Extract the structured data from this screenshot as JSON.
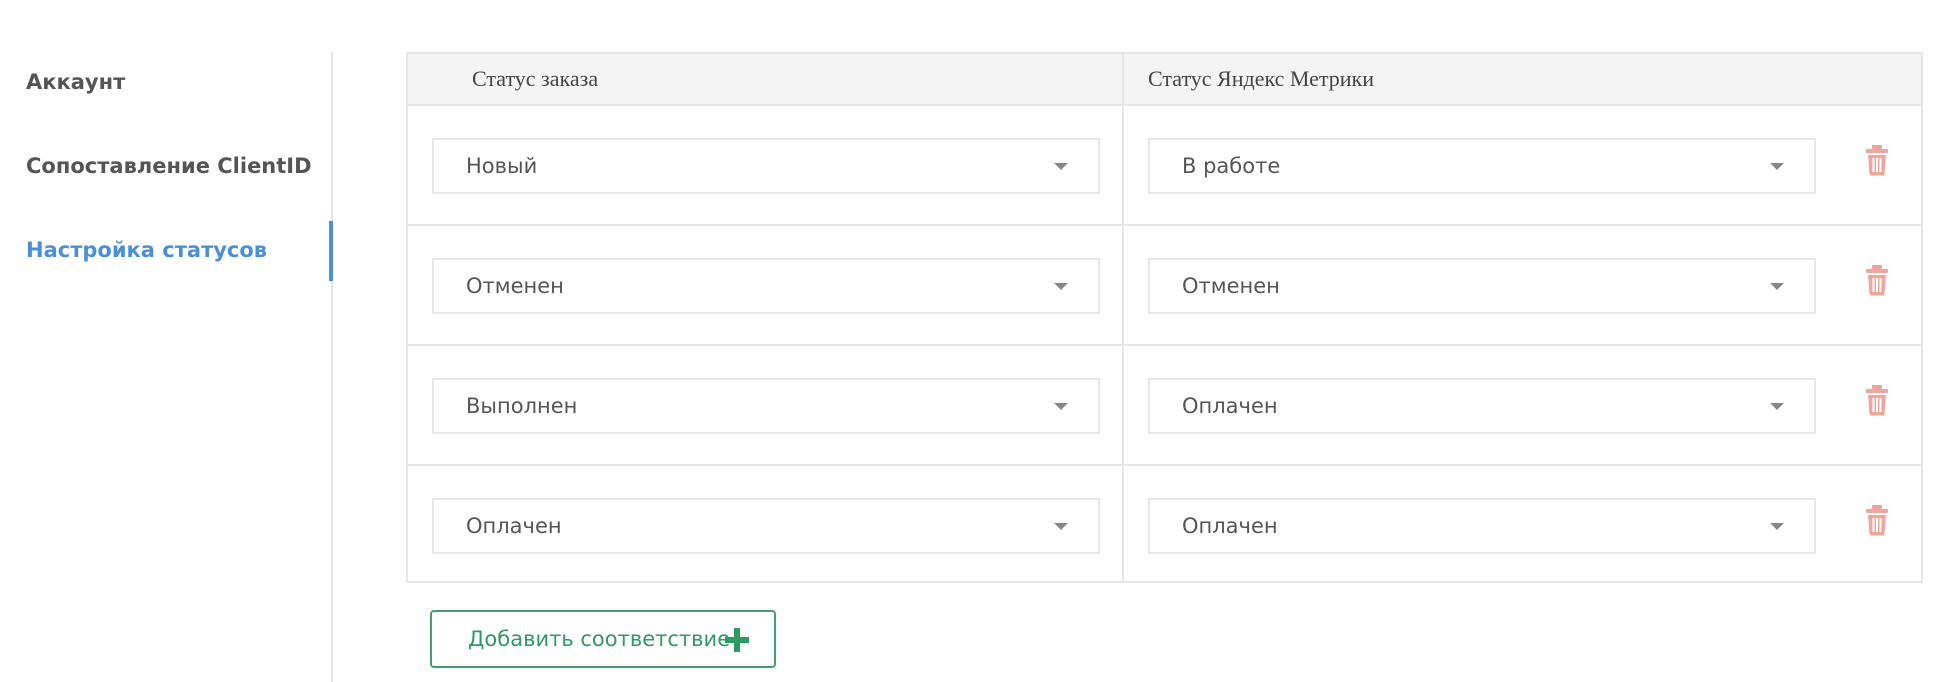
{
  "sidebar": {
    "items": [
      {
        "label": "Аккаунт",
        "active": false
      },
      {
        "label": "Сопоставление ClientID",
        "active": false
      },
      {
        "label": "Настройка статусов",
        "active": true
      }
    ]
  },
  "table": {
    "headers": {
      "order_status": "Статус заказа",
      "metrika_status": "Статус Яндекс Метрики"
    },
    "rows": [
      {
        "order_status": "Новый",
        "metrika_status": "В работе"
      },
      {
        "order_status": "Отменен",
        "metrika_status": "Отменен"
      },
      {
        "order_status": "Выполнен",
        "metrika_status": "Оплачен"
      },
      {
        "order_status": "Оплачен",
        "metrika_status": "Оплачен"
      }
    ]
  },
  "actions": {
    "add_mapping_label": "Добавить соответствие"
  },
  "icons": {
    "delete": "trash-icon",
    "add": "plus-icon",
    "select": "chevron-down-icon"
  },
  "colors": {
    "accent": "#4a90d9",
    "success": "#2f9a63",
    "danger": "#f2a49a",
    "header_bg": "#f4f4f4"
  }
}
